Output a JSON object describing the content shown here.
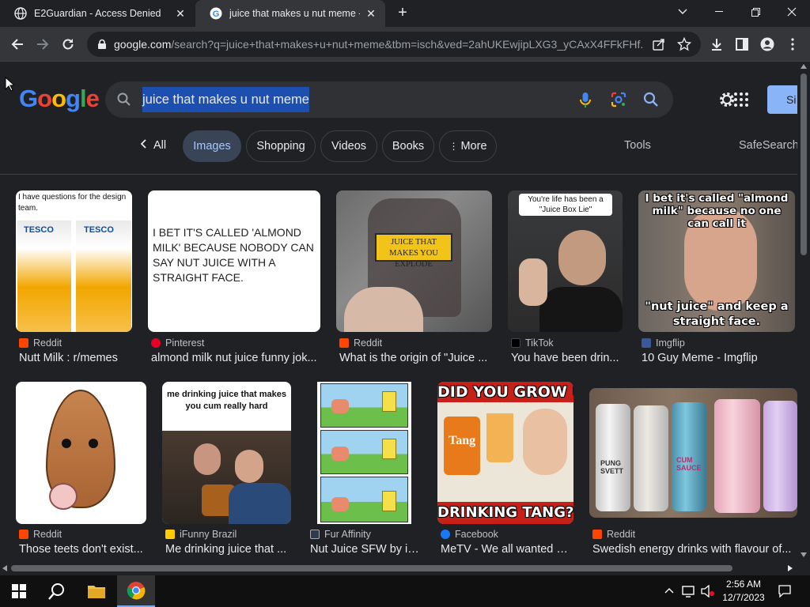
{
  "tabs": [
    {
      "title": "E2Guardian - Access Denied",
      "active": false
    },
    {
      "title": "juice that makes u nut meme - G",
      "active": true
    }
  ],
  "toolbar": {
    "url_host": "google.com",
    "url_path": "/search?q=juice+that+makes+u+nut+meme&tbm=isch&ved=2ahUKEwjipLXG3_yCAxX4FFkFHf..."
  },
  "google": {
    "logo_letters": [
      "G",
      "o",
      "o",
      "g",
      "l",
      "e"
    ],
    "logo_colors": [
      "#4285f4",
      "#ea4335",
      "#fbbc05",
      "#4285f4",
      "#34a853",
      "#ea4335"
    ],
    "query": "juice that makes u nut meme",
    "signin_label": "Si"
  },
  "chips": [
    {
      "label": "All",
      "active": false
    },
    {
      "label": "Images",
      "active": true
    },
    {
      "label": "Shopping",
      "active": false
    },
    {
      "label": "Videos",
      "active": false
    },
    {
      "label": "Books",
      "active": false
    },
    {
      "label": "More",
      "active": false
    }
  ],
  "tools": {
    "tools_label": "Tools",
    "safesearch_label": "SafeSearch"
  },
  "results_row1": [
    {
      "source": "Reddit",
      "source_color": "#ff4500",
      "caption": "Nutt Milk : r/memes",
      "thumb_text": "I have questions for the design team."
    },
    {
      "source": "Pinterest",
      "source_color": "#e60023",
      "caption": "almond milk nut juice funny jok...",
      "thumb_text": "I BET IT'S CALLED 'ALMOND MILK' BECAUSE NOBODY CAN SAY NUT JUICE WITH A STRAIGHT FACE."
    },
    {
      "source": "Reddit",
      "source_color": "#ff4500",
      "caption": "What is the origin of \"Juice ...",
      "thumb_text": "JUICE THAT MAKES YOU EXPLODE"
    },
    {
      "source": "TikTok",
      "source_color": "#000000",
      "caption": "You have been drin...",
      "thumb_text": "You're life has been a \"Juice Box Lie\""
    },
    {
      "source": "Imgflip",
      "source_color": "#3b5998",
      "caption": "10 Guy Meme - Imgflip",
      "thumb_text_top": "I bet it's called \"almond milk\" because no one can call it",
      "thumb_text_bottom": "\"nut juice\" and keep a straight face."
    }
  ],
  "results_row2": [
    {
      "source": "Reddit",
      "source_color": "#ff4500",
      "caption": "Those teets don't exist..."
    },
    {
      "source": "iFunny Brazil",
      "source_color": "#ffcc00",
      "caption": "Me drinking juice that ...",
      "thumb_text": "me drinking juice that makes you cum really hard"
    },
    {
      "source": "Fur Affinity",
      "source_color": "#2e3b4e",
      "caption": "Nut Juice SFW by ie..."
    },
    {
      "source": "Facebook",
      "source_color": "#1877f2",
      "caption": "MeTV - We all wanted w...",
      "thumb_text_top": "DID YOU GROW UP",
      "thumb_text_bottom": "DRINKING TANG?"
    },
    {
      "source": "Reddit",
      "source_color": "#ff4500",
      "caption": "Swedish energy drinks with flavour of..."
    }
  ],
  "taskbar": {
    "time": "2:56 AM",
    "date": "12/7/2023"
  }
}
